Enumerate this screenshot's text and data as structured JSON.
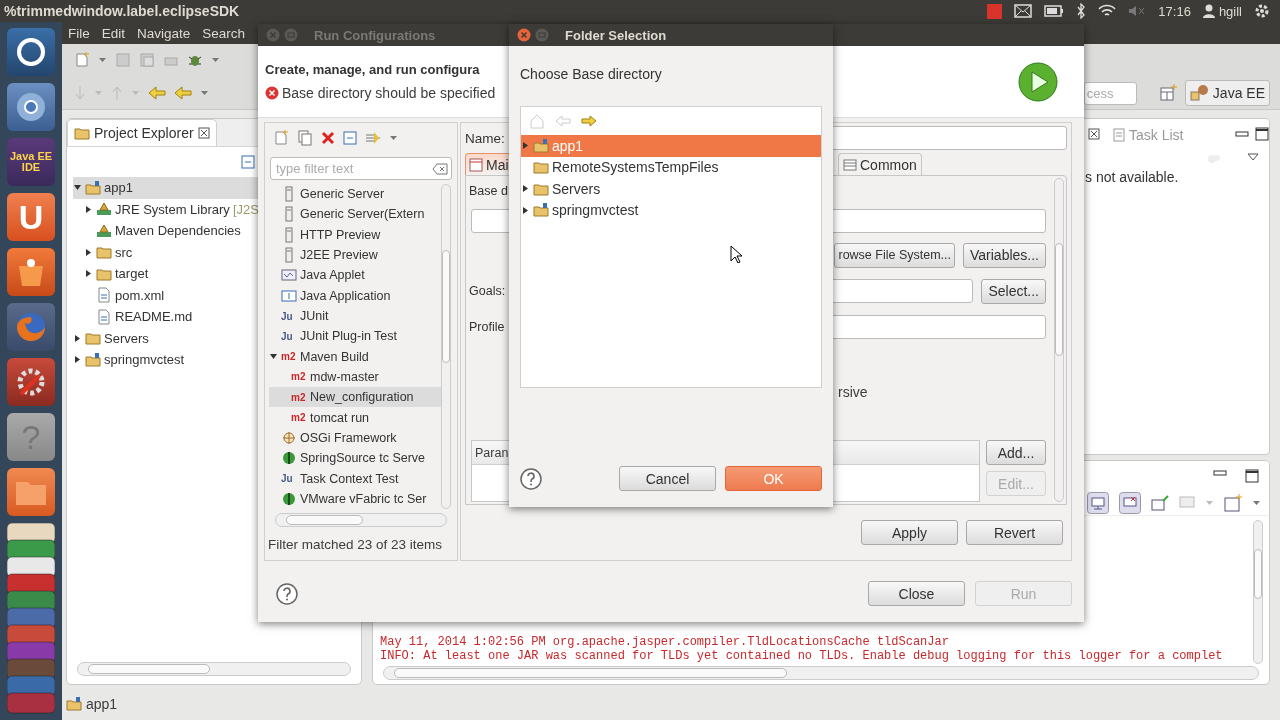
{
  "top_bar": {
    "title": "%trimmedwindow.label.eclipseSDK",
    "time": "17:16",
    "user": "hgill"
  },
  "launcher": [
    {
      "kind": "dash"
    },
    {
      "kind": "browser"
    },
    {
      "kind": "ide",
      "label": "Java EE IDE"
    },
    {
      "kind": "u",
      "label": "U"
    },
    {
      "kind": "store"
    },
    {
      "kind": "firefox"
    },
    {
      "kind": "settings"
    },
    {
      "kind": "help",
      "label": "?"
    },
    {
      "kind": "files"
    },
    {
      "kind": "stack"
    }
  ],
  "eclipse": {
    "menu": [
      "File",
      "Edit",
      "Navigate",
      "Search"
    ],
    "quick_access": {
      "placeholder": "cess"
    },
    "perspective": {
      "label": "Java EE"
    },
    "project_explorer": {
      "title": "Project Explorer",
      "tree": [
        {
          "label": "app1",
          "kind": "project",
          "expanded": true,
          "selected": true,
          "children": [
            {
              "label": "JRE System Library",
              "decoration": "[J2S",
              "kind": "library",
              "expanded": false,
              "selected": false
            },
            {
              "label": "Maven Dependencies",
              "kind": "library",
              "selected": false
            },
            {
              "label": "src",
              "kind": "folder",
              "expanded": false,
              "selected": false
            },
            {
              "label": "target",
              "kind": "folder",
              "expanded": false,
              "selected": false
            },
            {
              "label": "pom.xml",
              "kind": "file",
              "selected": false
            },
            {
              "label": "README.md",
              "kind": "file",
              "selected": false
            }
          ]
        },
        {
          "label": "Servers",
          "kind": "folder",
          "expanded": false,
          "selected": false
        },
        {
          "label": "springmvctest",
          "kind": "project",
          "expanded": false,
          "selected": false
        }
      ]
    },
    "task_list": {
      "tab": "Task List",
      "message": "s not available."
    },
    "console": {
      "lines": [
        "May 11, 2014 1:02:56 PM org.apache.jasper.compiler.TldLocationsCache tldScanJar",
        "INFO: At least one JAR was scanned for TLDs yet contained no TLDs. Enable debug logging for this logger for a complet"
      ]
    },
    "status_bar": {
      "text": "app1"
    }
  },
  "run_configurations": {
    "title": "Run Configurations",
    "heading": "Create, manage, and run configura",
    "error": "Base directory should be specified",
    "filter": {
      "placeholder": "type filter text"
    },
    "types": [
      {
        "label": "Generic Server",
        "kind": "server",
        "selected": false
      },
      {
        "label": "Generic Server(Extern",
        "kind": "server",
        "selected": false
      },
      {
        "label": "HTTP Preview",
        "kind": "server",
        "selected": false
      },
      {
        "label": "J2EE Preview",
        "kind": "server",
        "selected": false
      },
      {
        "label": "Java Applet",
        "kind": "applet",
        "selected": false
      },
      {
        "label": "Java Application",
        "kind": "app",
        "selected": false
      },
      {
        "label": "JUnit",
        "kind": "junit",
        "badge": "Ju",
        "selected": false
      },
      {
        "label": "JUnit Plug-in Test",
        "kind": "junit",
        "badge": "Ju",
        "selected": false
      },
      {
        "label": "Maven Build",
        "kind": "maven",
        "badge": "m2",
        "expanded": true,
        "selected": false,
        "children": [
          {
            "label": "mdw-master",
            "kind": "maven",
            "badge": "m2",
            "selected": false
          },
          {
            "label": "New_configuration",
            "kind": "maven",
            "badge": "m2",
            "selected": true
          },
          {
            "label": "tomcat run",
            "kind": "maven",
            "badge": "m2",
            "selected": false
          }
        ]
      },
      {
        "label": "OSGi Framework",
        "kind": "osgi",
        "selected": false
      },
      {
        "label": "SpringSource tc Serve",
        "kind": "spring",
        "selected": false
      },
      {
        "label": "Task Context Test",
        "kind": "junit",
        "badge": "Ju",
        "selected": false
      },
      {
        "label": "VMware vFabric tc Ser",
        "kind": "spring",
        "selected": false
      }
    ],
    "filter_status": "Filter matched 23 of 23 items",
    "name_label": "Name:",
    "tabs": [
      {
        "label": "Mai",
        "selected": true
      },
      {
        "label": "Common",
        "selected": false
      }
    ],
    "main": {
      "base_label": "Base d",
      "browse": "rowse File System...",
      "variables": "Variables...",
      "goals_label": "Goals:",
      "select": "Select...",
      "profiles_label": "Profile",
      "recursive": "rsive",
      "param_header": "Paran",
      "add": {
        "label": "Add...",
        "disabled": false
      },
      "edit": {
        "label": "Edit...",
        "disabled": true
      }
    },
    "buttons": [
      {
        "label": "Apply",
        "disabled": false
      },
      {
        "label": "Revert",
        "disabled": false
      }
    ],
    "footer_buttons": [
      {
        "label": "Close",
        "disabled": false
      },
      {
        "label": "Run",
        "disabled": true
      }
    ]
  },
  "folder_selection": {
    "title": "Folder Selection",
    "prompt": "Choose Base directory",
    "nav": [
      {
        "kind": "home",
        "disabled": true
      },
      {
        "kind": "back",
        "disabled": true
      },
      {
        "kind": "forward",
        "disabled": false
      }
    ],
    "tree": [
      {
        "label": "app1",
        "kind": "project",
        "expanded": false,
        "selected": true
      },
      {
        "label": "RemoteSystemsTempFiles",
        "kind": "folder",
        "selected": false
      },
      {
        "label": "Servers",
        "kind": "folder",
        "expanded": false,
        "selected": false
      },
      {
        "label": "springmvctest",
        "kind": "project",
        "expanded": false,
        "selected": false
      }
    ],
    "buttons": [
      {
        "label": "Cancel",
        "kind": "normal"
      },
      {
        "label": "OK",
        "kind": "default"
      }
    ]
  }
}
